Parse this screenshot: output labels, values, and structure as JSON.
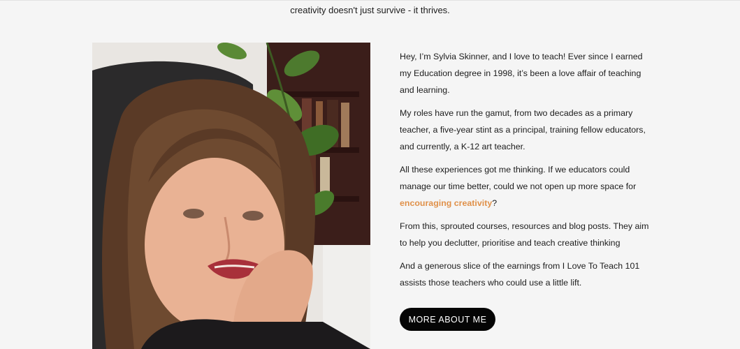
{
  "intro": {
    "text": "creativity doesn't just survive - it thrives."
  },
  "photo": {
    "subject": "portrait-photo"
  },
  "bio": {
    "p1": "Hey, I’m Sylvia Skinner, and I love to teach! Ever since I earned my Education degree in 1998, it’s been a love affair of teaching and learning.",
    "p2": "My roles have run the gamut, from two decades as a primary teacher, a five-year stint as a principal, training fellow educators, and currently, a K-12 art teacher.",
    "p3_before": "All these experiences got me thinking. If we educators could manage our time better, could we not open up more space for ",
    "p3_link": "encouraging creativity",
    "p3_after": "?",
    "p4": "From this, sprouted courses, resources and blog posts. They aim to help you declutter, prioritise and teach creative thinking",
    "p5": "And a generous slice of the earnings from I Love To Teach 101 assists those teachers who could use a little lift."
  },
  "cta": {
    "label": "MORE ABOUT ME"
  },
  "colors": {
    "background": "#f5f5f5",
    "link": "#e0914a",
    "button_bg": "#050505",
    "button_text": "#ffffff"
  }
}
